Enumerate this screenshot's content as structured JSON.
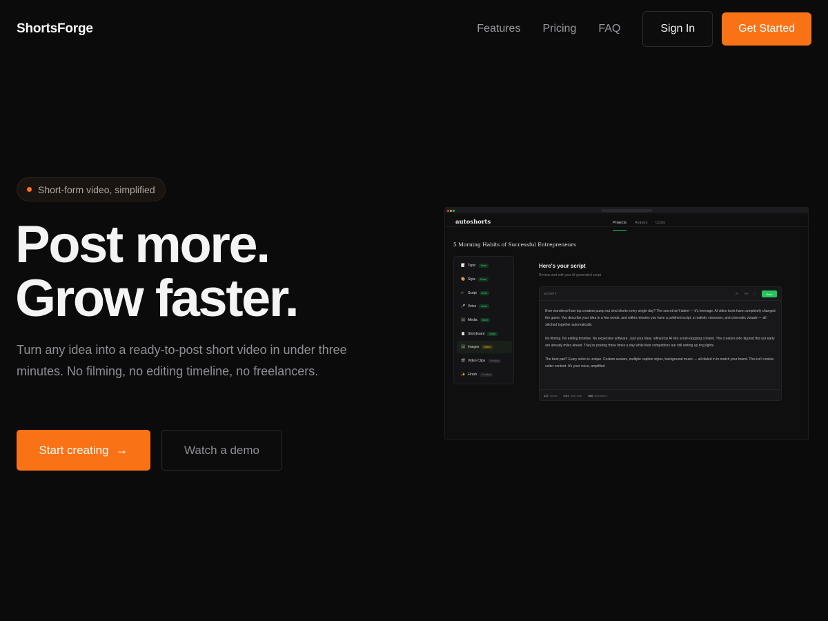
{
  "nav": {
    "logo": "ShortsForge",
    "links": [
      "Features",
      "Pricing",
      "FAQ"
    ],
    "signin_label": "Sign In",
    "getstarted_label": "Get Started"
  },
  "hero": {
    "badge": "Short-form video, simplified",
    "headline_line1": "Post more.",
    "headline_line2": "Grow faster.",
    "subtitle": "Turn any idea into a ready-to-post short video in under three minutes. No filming, no editing timeline, no freelancers.",
    "primary_cta": "Start creating",
    "secondary_cta": "Watch a demo"
  },
  "mockup": {
    "app_name": "autoshorts",
    "tabs": [
      "Projects",
      "Avatars",
      "Costs"
    ],
    "project_title": "5 Morning Habits of Successful Entrepreneurs",
    "steps": [
      {
        "icon": "📝",
        "label": "Topic",
        "status": "Done"
      },
      {
        "icon": "🎨",
        "label": "Style",
        "status": "Done"
      },
      {
        "icon": "✍",
        "label": "Script",
        "status": "Done"
      },
      {
        "icon": "🎤",
        "label": "Voice",
        "status": "Done"
      },
      {
        "icon": "🖼",
        "label": "Media",
        "status": "Done"
      },
      {
        "icon": "📋",
        "label": "Storyboard",
        "status": "Done"
      },
      {
        "icon": "🖼",
        "label": "Images",
        "status": "Active"
      },
      {
        "icon": "🎬",
        "label": "Video Clips",
        "status": "Pending"
      },
      {
        "icon": "✨",
        "label": "Finish",
        "status": "Pending"
      }
    ],
    "script_heading": "Here's your script",
    "script_sub": "Review and edit your AI-generated script",
    "editor_label": "SCRIPT",
    "tools": [
      "A-",
      "A+",
      "⛶"
    ],
    "save_label": "Save",
    "paragraphs": [
      "Ever wondered how top creators pump out viral shorts every single day? The secret isn't talent — it's leverage. AI video tools have completely changed the game. You describe your idea in a few words, and within minutes you have a polished script, a realistic voiceover, and cinematic visuals — all stitched together automatically.",
      "No filming. No editing timeline. No expensive software. Just your idea, refined by AI into scroll-stopping content. The creators who figured this out early are already miles ahead. They're posting three times a day while their competitors are still setting up ring lights.",
      "The best part? Every video is unique. Custom avatars, multiple caption styles, background music — all dialed in to match your brand. This isn't cookie-cutter content. It's your voice, amplified."
    ],
    "footer": [
      {
        "value": "127",
        "label": "words"
      },
      {
        "value": "0:51",
        "label": "read time"
      },
      {
        "value": "888",
        "label": "characters"
      }
    ]
  },
  "colors": {
    "accent": "#f97316",
    "background": "#0b0b0c",
    "success": "#22c55e"
  }
}
